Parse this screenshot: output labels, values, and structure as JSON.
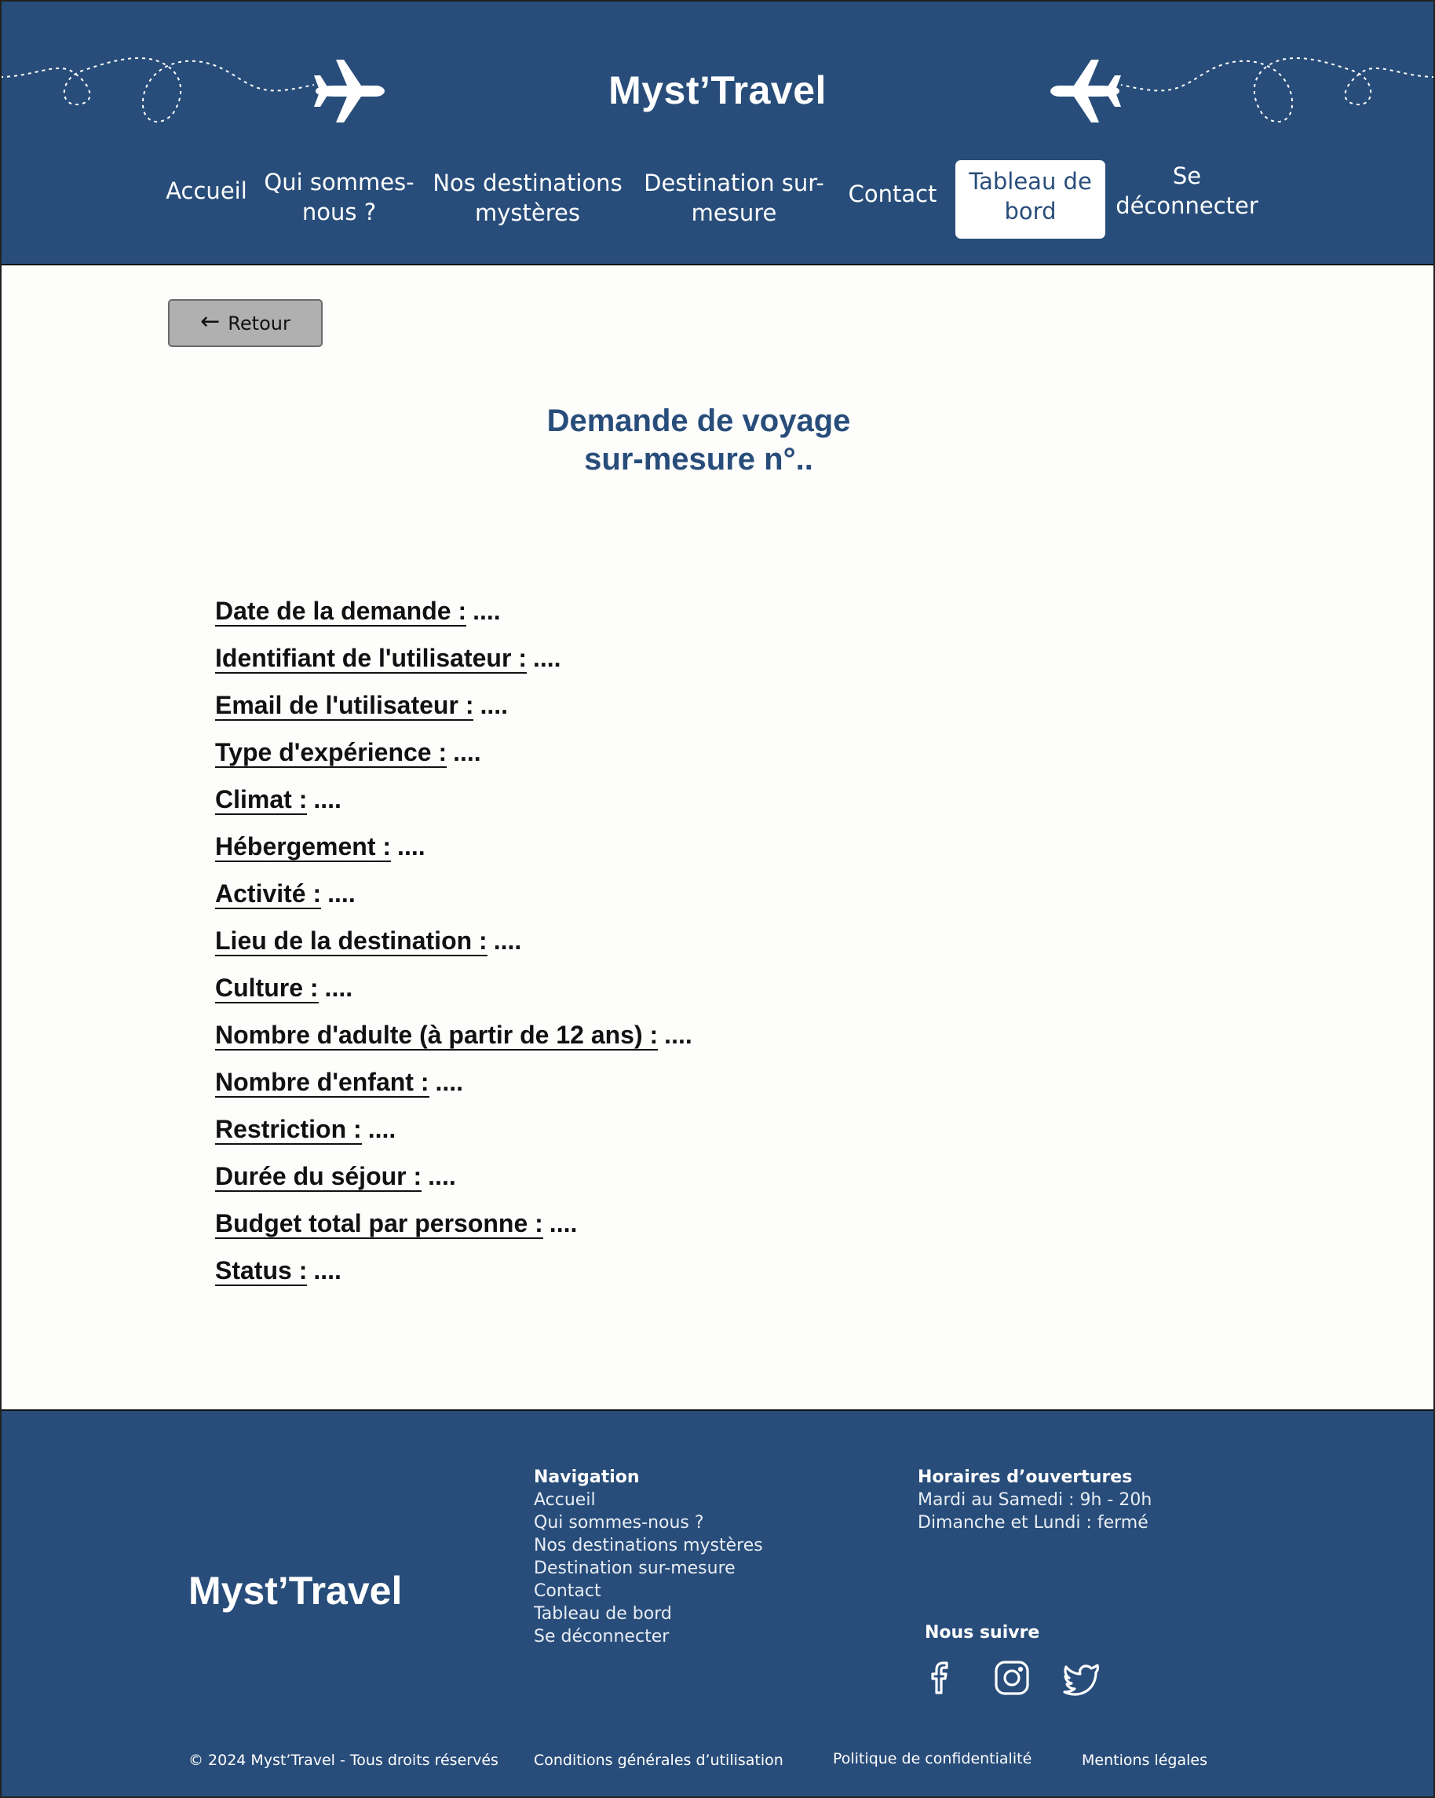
{
  "header": {
    "brand": "Myst’Travel",
    "nav": [
      {
        "label": "Accueil"
      },
      {
        "label": "Qui sommes-nous ?"
      },
      {
        "label": "Nos destinations mystères"
      },
      {
        "label": "Destination sur-mesure"
      },
      {
        "label": "Contact"
      },
      {
        "label": "Tableau de bord"
      },
      {
        "label": "Se déconnecter"
      }
    ],
    "active_nav": "Tableau de bord",
    "icons": [
      "airplane-icon",
      "airplane-icon"
    ]
  },
  "main": {
    "back_label": "Retour",
    "title_line1": "Demande de voyage",
    "title_line2": "sur-mesure n°..",
    "fields": [
      {
        "label": "Date de la demande :",
        "value": "...."
      },
      {
        "label": "Identifiant de l'utilisateur :",
        "value": "...."
      },
      {
        "label": "Email de l'utilisateur :",
        "value": "...."
      },
      {
        "label": "Type d'expérience :",
        "value": "...."
      },
      {
        "label": "Climat :",
        "value": "...."
      },
      {
        "label": "Hébergement :",
        "value": "...."
      },
      {
        "label": "Activité :",
        "value": "...."
      },
      {
        "label": "Lieu de la destination :",
        "value": "...."
      },
      {
        "label": "Culture :",
        "value": "...."
      },
      {
        "label": "Nombre d'adulte (à partir de 12 ans) :",
        "value": "...."
      },
      {
        "label": "Nombre d'enfant :",
        "value": "...."
      },
      {
        "label": "Restriction :",
        "value": "...."
      },
      {
        "label": "Durée du séjour :",
        "value": "...."
      },
      {
        "label": "Budget total par personne :",
        "value": "...."
      },
      {
        "label": "Status :",
        "value": "...."
      }
    ]
  },
  "footer": {
    "brand": "Myst’Travel",
    "nav_title": "Navigation",
    "nav_links": [
      "Accueil",
      "Qui sommes-nous ?",
      "Nos destinations mystères",
      "Destination sur-mesure",
      "Contact",
      "Tableau de bord",
      "Se déconnecter"
    ],
    "hours_title": "Horaires d’ouvertures",
    "hours": [
      "Mardi au Samedi : 9h - 20h",
      "Dimanche et Lundi : fermé"
    ],
    "follow_title": "Nous suivre",
    "social_icons": [
      "facebook-icon",
      "instagram-icon",
      "twitter-icon"
    ],
    "copyright": "© 2024 Myst’Travel - Tous droits réservés",
    "cgu": "Conditions générales d’utilisation",
    "privacy": "Politique de confidentialité",
    "legal": "Mentions légales"
  },
  "colors": {
    "primary": "#284d7a",
    "background": "#fdfdfc",
    "button_grey": "#b0b0b0"
  }
}
